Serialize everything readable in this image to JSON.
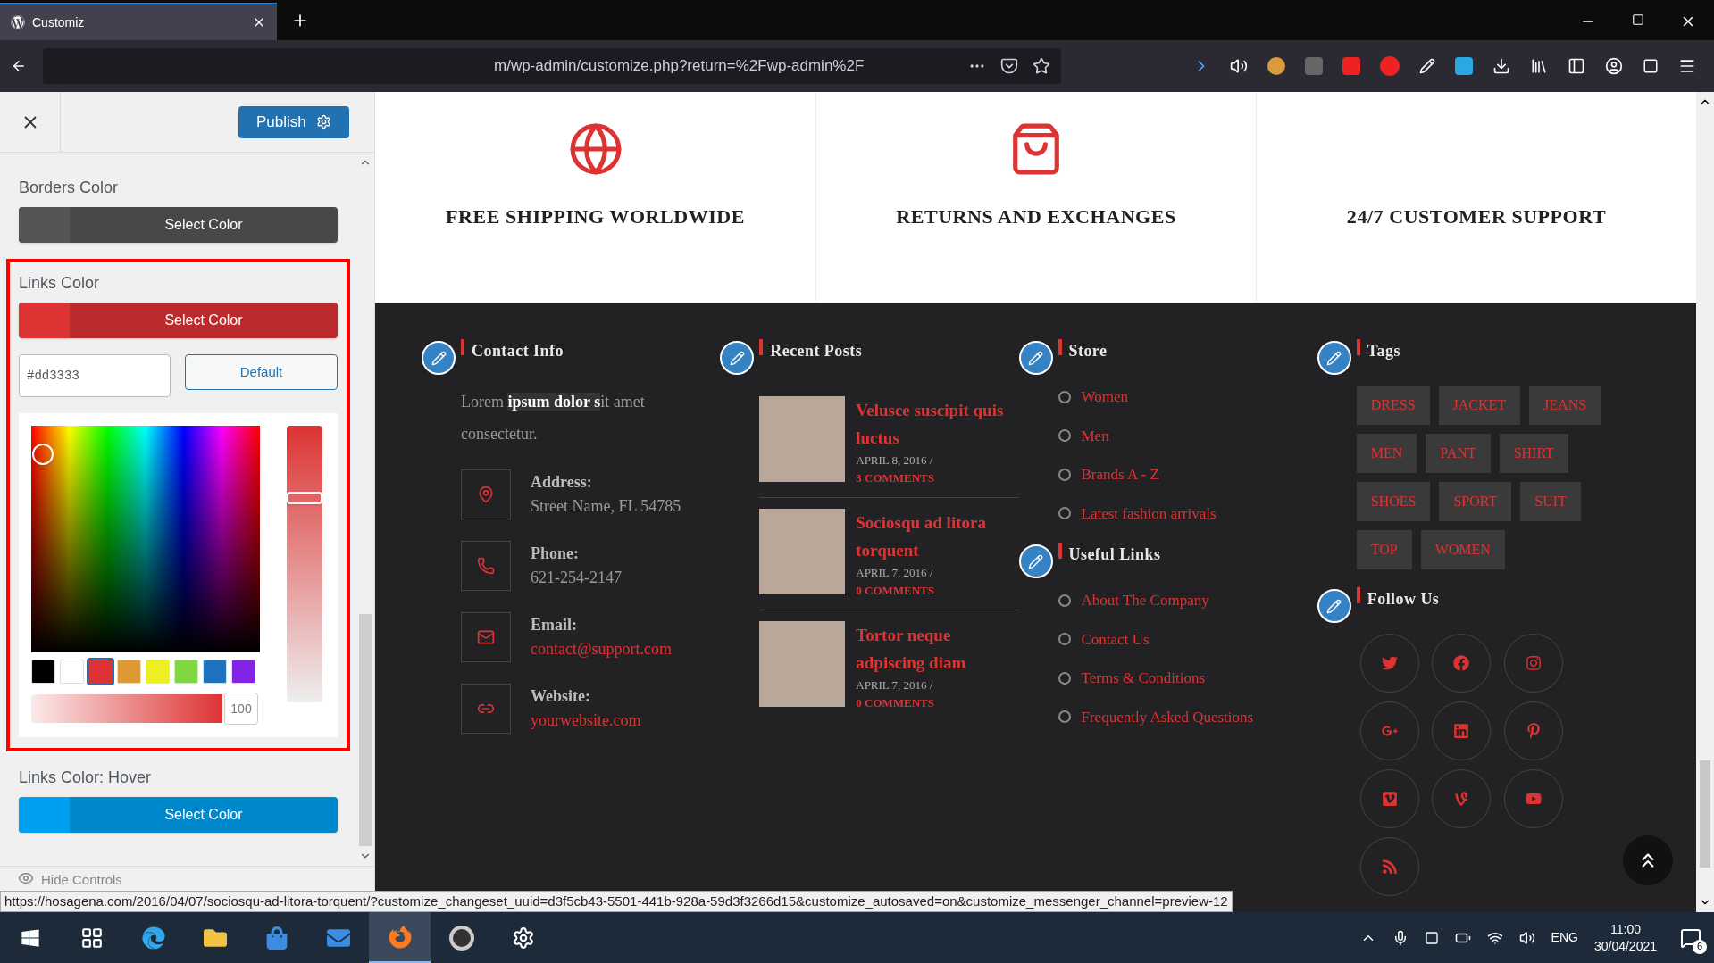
{
  "browser": {
    "tabs": [
      {
        "title": "Customiz",
        "selected": true
      }
    ],
    "url": "m/wp-admin/customize.php?return=%2Fwp-admin%2F"
  },
  "customizer": {
    "publish": "Publish",
    "sections": [
      {
        "label": "Borders Color",
        "button": "Select Color",
        "color": "#555555",
        "highlighted": false
      },
      {
        "label": "Links Color",
        "button": "Select Color",
        "color": "#dd3333",
        "highlighted": true,
        "picker": {
          "hex": "#dd3333",
          "default": "Default",
          "level": 0.75,
          "alpha": "100",
          "swatches": [
            {
              "color": "#000000",
              "selected": false
            },
            {
              "color": "#ffffff",
              "selected": false
            },
            {
              "color": "#dd3333",
              "selected": true
            },
            {
              "color": "#dd9933",
              "selected": false
            },
            {
              "color": "#eeee22",
              "selected": false
            },
            {
              "color": "#81d742",
              "selected": false
            },
            {
              "color": "#1e73be",
              "selected": false
            },
            {
              "color": "#8224e3",
              "selected": false
            }
          ]
        }
      },
      {
        "label": "Links Color: Hover",
        "button": "Select Color",
        "color": "#00a0f0",
        "highlighted": false
      }
    ],
    "hide_controls": "Hide Controls"
  },
  "features": [
    {
      "kind": "globe",
      "title": "FREE SHIPPING WORLDWIDE"
    },
    {
      "kind": "bag",
      "title": "RETURNS AND EXCHANGES"
    },
    {
      "kind": "text",
      "title": "24/7 CUSTOMER SUPPORT"
    }
  ],
  "contact": {
    "heading": "Contact Info",
    "intro": [
      {
        "text": "Lorem ",
        "selected": false
      },
      {
        "text": "ipsum dolor s",
        "selected": true
      },
      {
        "text": "it amet consectetur.",
        "selected": false
      }
    ],
    "items": [
      {
        "kind": "address",
        "label": "Address:",
        "value": "Street Name, FL 54785"
      },
      {
        "kind": "phone",
        "label": "Phone:",
        "value": "621-254-2147"
      },
      {
        "kind": "email",
        "label": "Email:",
        "value": "contact@support.com"
      },
      {
        "kind": "website",
        "label": "Website:",
        "value": "yourwebsite.com"
      }
    ]
  },
  "recent_posts": {
    "heading": "Recent Posts",
    "posts": [
      {
        "title": "Velusce suscipit quis luctus",
        "date": "APRIL 8, 2016 /",
        "comments": "3 COMMENTS"
      },
      {
        "title": "Sociosqu ad litora torquent",
        "date": "APRIL 7, 2016 /",
        "comments": "0 COMMENTS"
      },
      {
        "title": "Tortor neque adpiscing diam",
        "date": "APRIL 7, 2016 /",
        "comments": "0 COMMENTS"
      }
    ]
  },
  "store": {
    "heading": "Store",
    "links": [
      "Women",
      "Men",
      "Brands A - Z",
      "Latest fashion arrivals"
    ]
  },
  "useful_links": {
    "heading": "Useful Links",
    "links": [
      "About The Company",
      "Contact Us",
      "Terms & Conditions",
      "Frequently Asked Questions"
    ]
  },
  "tags": {
    "heading": "Tags",
    "items": [
      "DRESS",
      "JACKET",
      "JEANS",
      "MEN",
      "PANT",
      "SHIRT",
      "SHOES",
      "SPORT",
      "SUIT",
      "TOP",
      "WOMEN"
    ]
  },
  "follow": {
    "heading": "Follow Us",
    "networks": [
      {
        "kind": "twitter"
      },
      {
        "kind": "facebook"
      },
      {
        "kind": "instagram"
      },
      {
        "kind": "googleplus"
      },
      {
        "kind": "linkedin"
      },
      {
        "kind": "pinterest"
      },
      {
        "kind": "vimeo"
      },
      {
        "kind": "vine"
      },
      {
        "kind": "youtube"
      },
      {
        "kind": "rss"
      }
    ]
  },
  "status_url": "https://hosagena.com/2016/04/07/sociosqu-ad-litora-torquent/?customize_changeset_uuid=d3f5cb43-5501-441b-928a-59d3f3266d15&customize_autosaved=on&customize_messenger_channel=preview-12",
  "taskbar": {
    "apps": [
      {
        "kind": "taskview",
        "selected": false
      },
      {
        "kind": "edge",
        "selected": false
      },
      {
        "kind": "explorer",
        "selected": false
      },
      {
        "kind": "store",
        "selected": false
      },
      {
        "kind": "mail",
        "selected": false
      },
      {
        "kind": "firefox",
        "selected": true
      },
      {
        "kind": "obs",
        "selected": false
      },
      {
        "kind": "settings",
        "selected": false
      }
    ],
    "language": "ENG",
    "time": "11:00",
    "date": "30/04/2021",
    "notifications": "6"
  }
}
